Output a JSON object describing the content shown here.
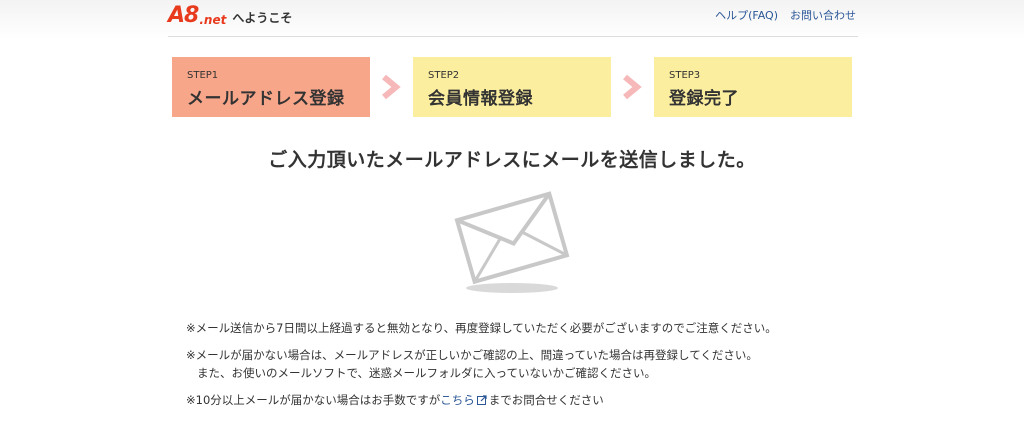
{
  "header": {
    "logo_a8": "A8",
    "logo_net": ".net",
    "welcome": "へようこそ",
    "links": [
      "ヘルプ(FAQ)",
      "お問い合わせ"
    ]
  },
  "steps": [
    {
      "label": "STEP1",
      "name": "メールアドレス登録",
      "active": true
    },
    {
      "label": "STEP2",
      "name": "会員情報登録",
      "active": false
    },
    {
      "label": "STEP3",
      "name": "登録完了",
      "active": false
    }
  ],
  "headline": "ご入力頂いたメールアドレスにメールを送信しました。",
  "notes": {
    "note1": "※メール送信から7日間以上経過すると無効となり、再度登録していただく必要がございますのでご注意ください。",
    "note2_line1": "※メールが届かない場合は、メールアドレスが正しいかご確認の上、間違っていた場合は再登録してください。",
    "note2_line2": "また、お使いのメールソフトで、迷惑メールフォルダに入っていないかご確認ください。",
    "note3_before": "※10分以上メールが届かない場合はお手数ですが",
    "note3_link": "こちら",
    "note3_after": "までお問合せください"
  },
  "colors": {
    "active_step": "#f7a68a",
    "inactive_step": "#fbee9e",
    "arrow": "#f6b8b8",
    "brand": "#e83a1d",
    "link": "#2b5797"
  },
  "icons": [
    "envelope-icon",
    "step-arrow-icon",
    "external-link-icon"
  ]
}
